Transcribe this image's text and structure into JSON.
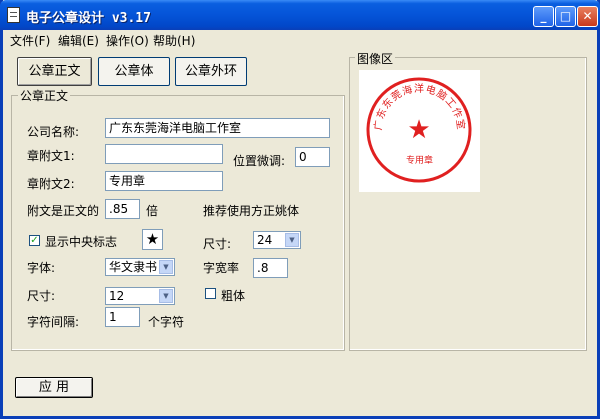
{
  "window": {
    "title": "电子公章设计  v3.17",
    "controls": {
      "minimize": "_",
      "maximize": "□",
      "close": "✕"
    }
  },
  "menu": [
    {
      "label": "文件(F)"
    },
    {
      "label": "编辑(E)"
    },
    {
      "label": "操作(O)"
    },
    {
      "label": "帮助(H)"
    }
  ],
  "tabs": [
    {
      "label": "公章正文"
    },
    {
      "label": "公章体"
    },
    {
      "label": "公章外环"
    }
  ],
  "group_main": {
    "legend": "公章正文",
    "company_label": "公司名称:",
    "company_value": "广东东莞海洋电脑工作室",
    "attach1_label": "章附文1:",
    "attach1_value": "",
    "position_adjust_label": "位置微调:",
    "position_adjust_value": "0",
    "attach2_label": "章附文2:",
    "attach2_value": "专用章",
    "ratio_label": "附文是正文的",
    "ratio_value": ".85",
    "ratio_unit": "倍",
    "recommend_text": "推荐使用方正姚体",
    "show_emblem_label": "显示中央标志",
    "show_emblem_checked": true,
    "emblem_symbol": "★",
    "size_label_1": "尺寸:",
    "size_value_1": "24",
    "font_label": "字体:",
    "font_value": "华文隶书",
    "width_ratio_label": "字宽率",
    "width_ratio_value": ".8",
    "size_label_2": "尺寸:",
    "size_value_2": "12",
    "bold_label": "粗体",
    "bold_checked": false,
    "spacing_label": "字符间隔:",
    "spacing_value": "1",
    "spacing_unit": "个字符"
  },
  "group_image": {
    "legend": "图像区",
    "seal_text": "广东东莞海洋电脑工作室",
    "seal_bottom": "专用章",
    "seal_star": "★"
  },
  "apply_button": "应 用",
  "colors": {
    "seal_red": "#e02020",
    "title_blue": "#0554d8"
  }
}
